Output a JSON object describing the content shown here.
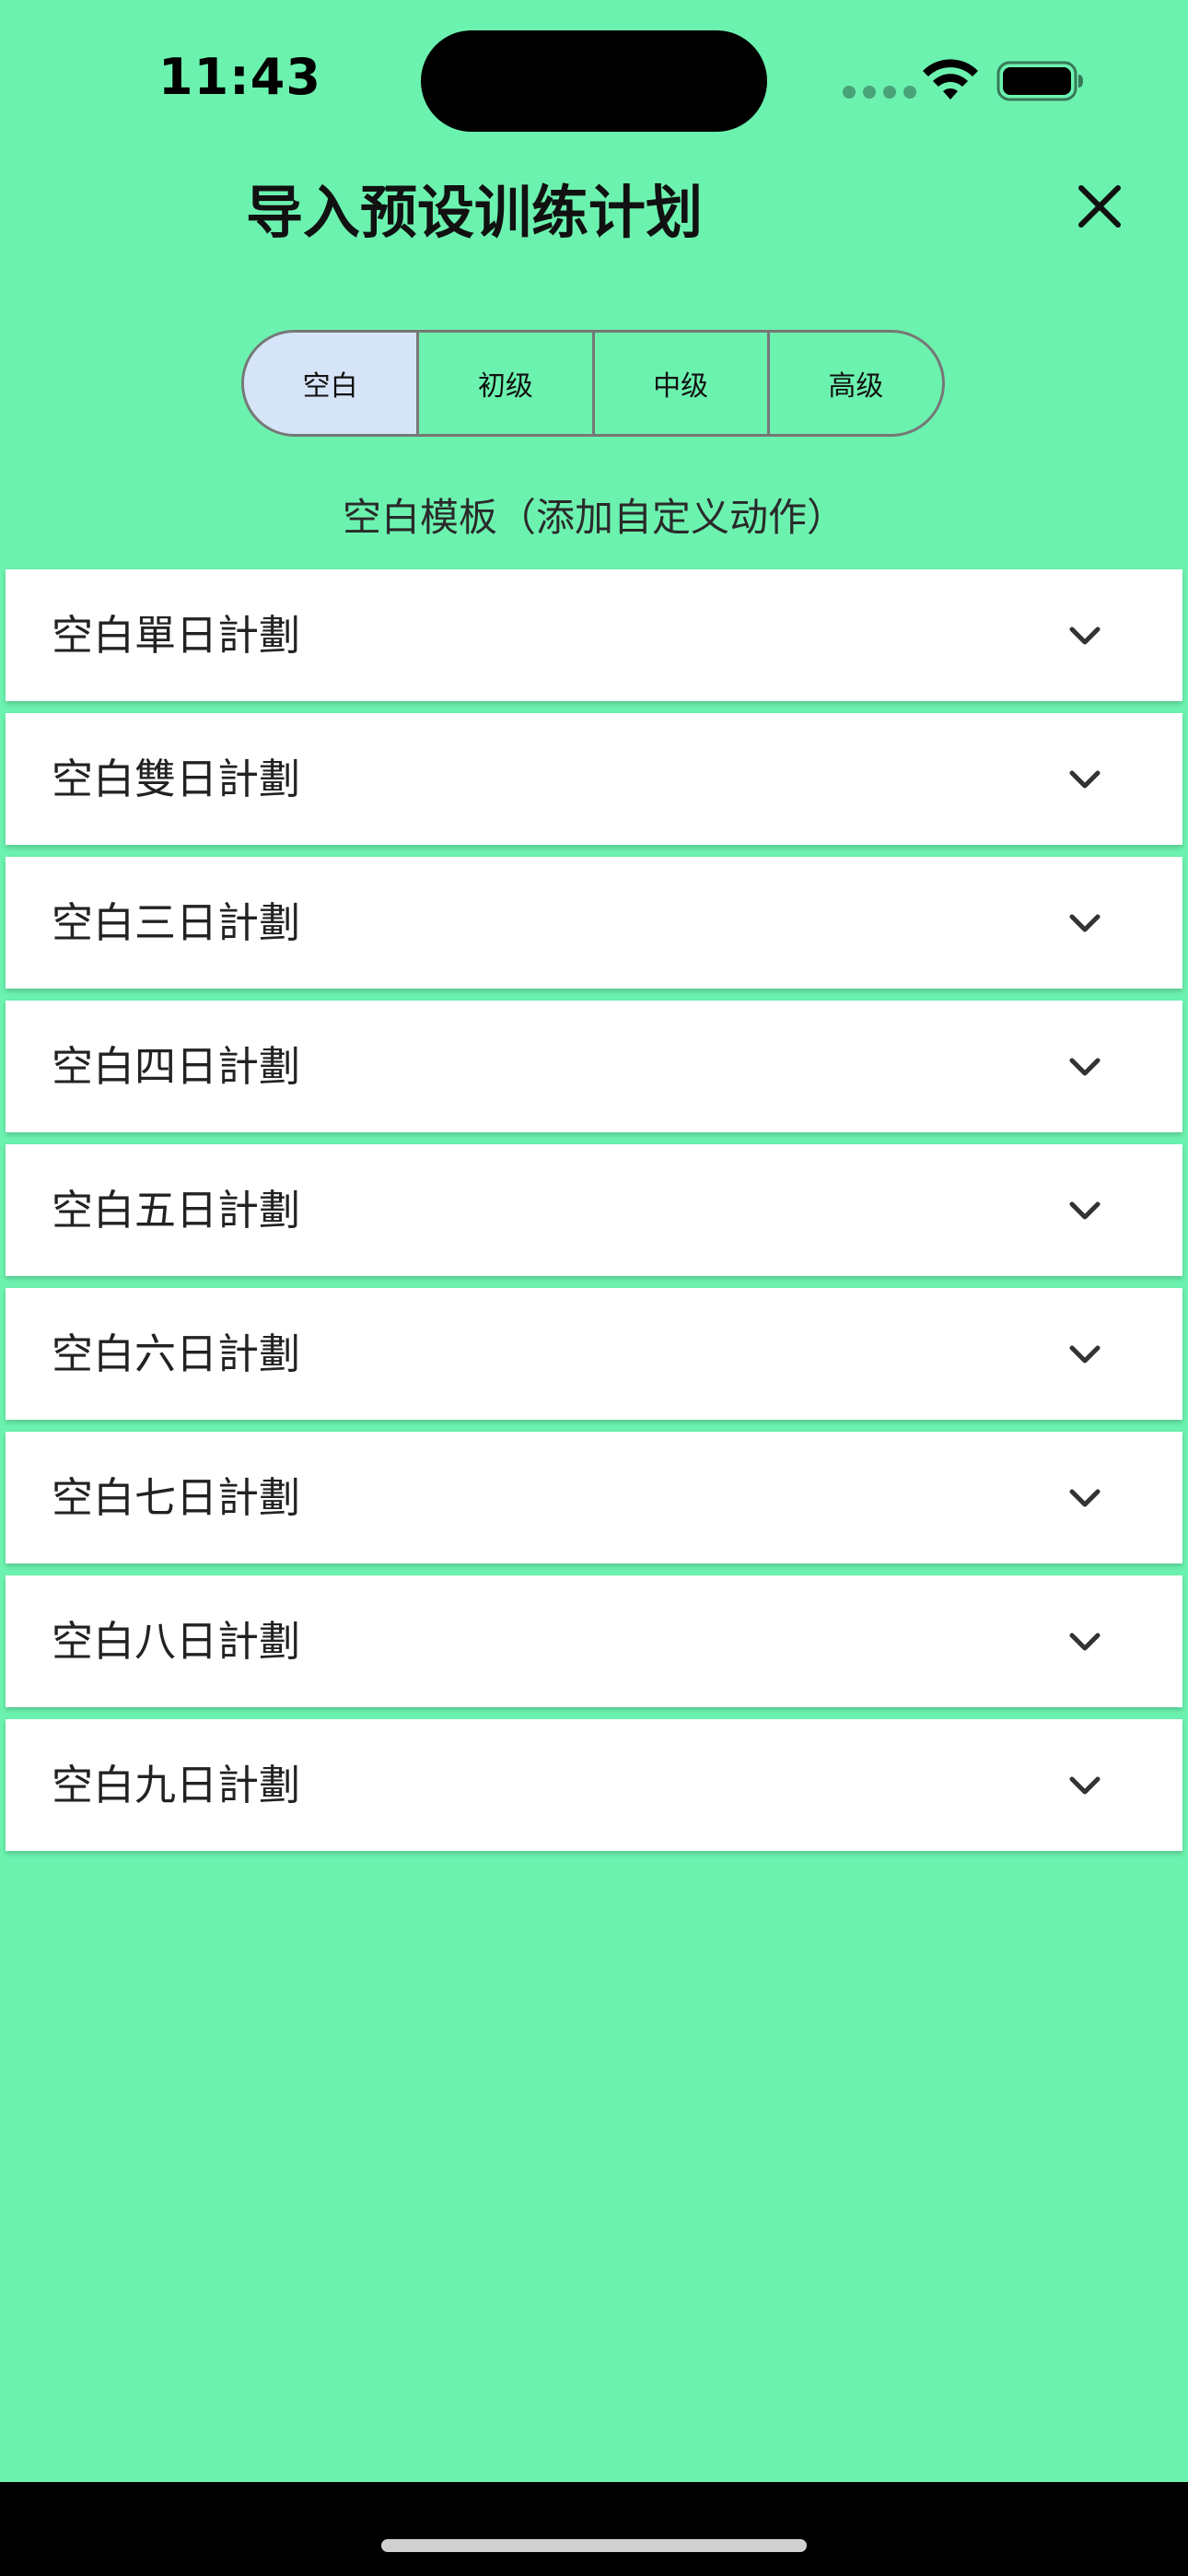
{
  "status_bar": {
    "time": "11:43"
  },
  "header": {
    "title": "导入预设训练计划"
  },
  "tabs": [
    {
      "label": "空白",
      "selected": true
    },
    {
      "label": "初级",
      "selected": false
    },
    {
      "label": "中级",
      "selected": false
    },
    {
      "label": "高级",
      "selected": false
    }
  ],
  "subtitle": "空白模板（添加自定义动作）",
  "plans": [
    {
      "label": "空白單日計劃"
    },
    {
      "label": "空白雙日計劃"
    },
    {
      "label": "空白三日計劃"
    },
    {
      "label": "空白四日計劃"
    },
    {
      "label": "空白五日計劃"
    },
    {
      "label": "空白六日計劃"
    },
    {
      "label": "空白七日計劃"
    },
    {
      "label": "空白八日計劃"
    },
    {
      "label": "空白九日計劃"
    }
  ],
  "colors": {
    "background": "#6CF2AF",
    "selected_tab": "#D6E4F7",
    "card": "#FFFFFF"
  },
  "icons": {
    "close": "close-icon",
    "expand": "chevron-down-icon",
    "wifi": "wifi-icon",
    "battery": "battery-icon"
  }
}
